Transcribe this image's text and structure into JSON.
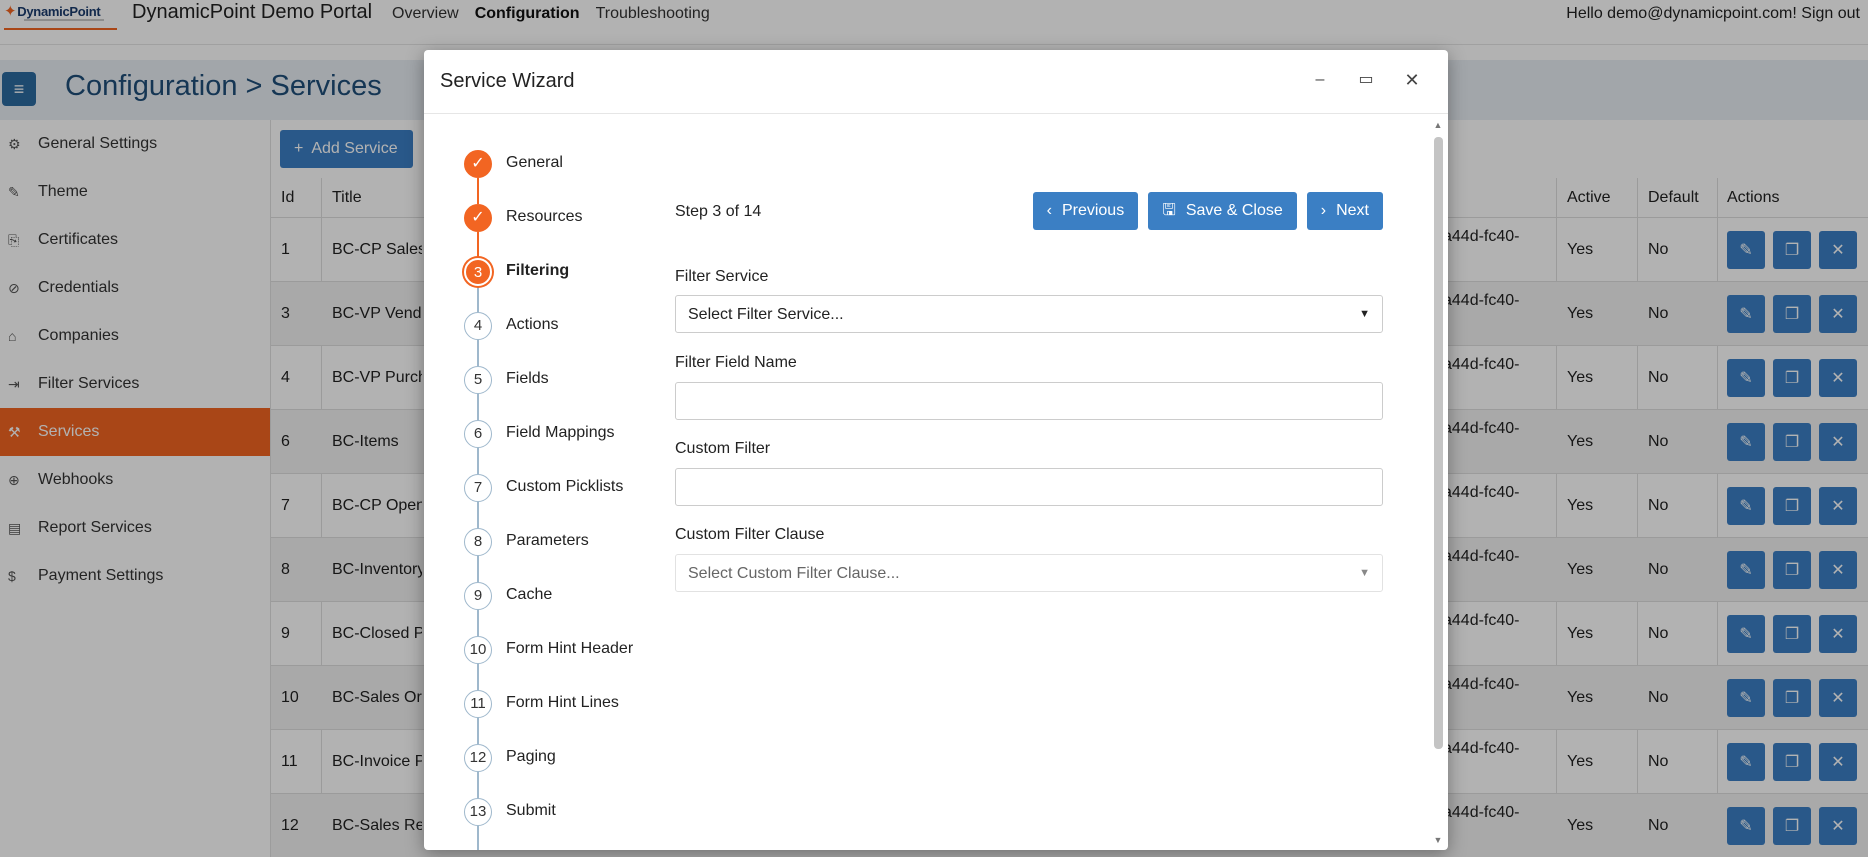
{
  "app": {
    "logo_text": "DynamicPoint",
    "title": "DynamicPoint Demo Portal",
    "greeting": "Hello demo@dynamicpoint.com!",
    "signout": "Sign out"
  },
  "topnav": [
    {
      "label": "Overview",
      "active": false
    },
    {
      "label": "Configuration",
      "active": true
    },
    {
      "label": "Troubleshooting",
      "active": false
    }
  ],
  "page": {
    "title": "Configuration > Services"
  },
  "sidebar": {
    "items": [
      {
        "label": "General Settings",
        "icon": "gear-icon",
        "glyph": "⚙",
        "active": false
      },
      {
        "label": "Theme",
        "icon": "brush-icon",
        "glyph": "✎",
        "active": false
      },
      {
        "label": "Certificates",
        "icon": "certificate-icon",
        "glyph": "⎘",
        "active": false
      },
      {
        "label": "Credentials",
        "icon": "ban-icon",
        "glyph": "⊘",
        "active": false
      },
      {
        "label": "Companies",
        "icon": "home-icon",
        "glyph": "⌂",
        "active": false
      },
      {
        "label": "Filter Services",
        "icon": "filter-arrow-icon",
        "glyph": "⇥",
        "active": false
      },
      {
        "label": "Services",
        "icon": "wrench-icon",
        "glyph": "⚒",
        "active": true
      },
      {
        "label": "Webhooks",
        "icon": "globe-icon",
        "glyph": "⊕",
        "active": false
      },
      {
        "label": "Report Services",
        "icon": "report-icon",
        "glyph": "▤",
        "active": false
      },
      {
        "label": "Payment Settings",
        "icon": "dollar-icon",
        "glyph": "$",
        "active": false
      }
    ]
  },
  "table": {
    "add_label": "Add Service",
    "headers": {
      "id": "Id",
      "title": "Title",
      "active": "Active",
      "default": "Default",
      "actions": "Actions"
    },
    "rows": [
      {
        "id": "1",
        "title": "BC-CP Sales C",
        "guid": "a44d-fc40-",
        "active": "Yes",
        "default": "No"
      },
      {
        "id": "3",
        "title": "BC-VP Vendo",
        "guid": "a44d-fc40-",
        "active": "Yes",
        "default": "No"
      },
      {
        "id": "4",
        "title": "BC-VP Purcha",
        "guid": "a44d-fc40-",
        "active": "Yes",
        "default": "No"
      },
      {
        "id": "6",
        "title": "BC-Items",
        "guid": "a44d-fc40-",
        "active": "Yes",
        "default": "No"
      },
      {
        "id": "7",
        "title": "BC-CP Open",
        "guid": "a44d-fc40-",
        "active": "Yes",
        "default": "No"
      },
      {
        "id": "8",
        "title": "BC-Inventory",
        "guid": "a44d-fc40-",
        "active": "Yes",
        "default": "No"
      },
      {
        "id": "9",
        "title": "BC-Closed Pu",
        "guid": "a44d-fc40-",
        "active": "Yes",
        "default": "No"
      },
      {
        "id": "10",
        "title": "BC-Sales Ord",
        "guid": "a44d-fc40-",
        "active": "Yes",
        "default": "No"
      },
      {
        "id": "11",
        "title": "BC-Invoice Pa",
        "guid": "a44d-fc40-",
        "active": "Yes",
        "default": "No"
      },
      {
        "id": "12",
        "title": "BC-Sales Retu",
        "guid": "a44d-fc40-",
        "active": "Yes",
        "default": "No"
      }
    ]
  },
  "modal": {
    "title": "Service Wizard",
    "step_info": "Step 3 of 14",
    "buttons": {
      "previous": "Previous",
      "save_close": "Save & Close",
      "next": "Next"
    },
    "steps": [
      {
        "num": "1",
        "label": "General",
        "state": "done"
      },
      {
        "num": "2",
        "label": "Resources",
        "state": "done"
      },
      {
        "num": "3",
        "label": "Filtering",
        "state": "current"
      },
      {
        "num": "4",
        "label": "Actions",
        "state": "todo"
      },
      {
        "num": "5",
        "label": "Fields",
        "state": "todo"
      },
      {
        "num": "6",
        "label": "Field Mappings",
        "state": "todo"
      },
      {
        "num": "7",
        "label": "Custom Picklists",
        "state": "todo"
      },
      {
        "num": "8",
        "label": "Parameters",
        "state": "todo"
      },
      {
        "num": "9",
        "label": "Cache",
        "state": "todo"
      },
      {
        "num": "10",
        "label": "Form Hint Header",
        "state": "todo"
      },
      {
        "num": "11",
        "label": "Form Hint Lines",
        "state": "todo"
      },
      {
        "num": "12",
        "label": "Paging",
        "state": "todo"
      },
      {
        "num": "13",
        "label": "Submit",
        "state": "todo"
      }
    ],
    "fields": {
      "filter_service": {
        "label": "Filter Service",
        "value": "Select Filter Service..."
      },
      "filter_field_name": {
        "label": "Filter Field Name",
        "value": ""
      },
      "custom_filter": {
        "label": "Custom Filter",
        "value": ""
      },
      "custom_filter_clause": {
        "label": "Custom Filter Clause",
        "placeholder": "Select Custom Filter Clause..."
      }
    }
  },
  "colors": {
    "accent": "#f26522",
    "primary": "#3b7fc4",
    "header_blue": "#1f4e79"
  }
}
